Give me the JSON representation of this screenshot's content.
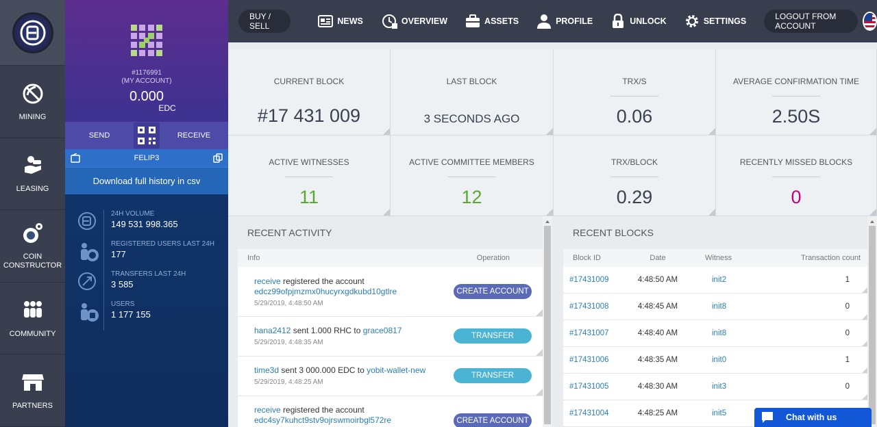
{
  "rail": {
    "items": [
      {
        "label": "MINING",
        "icon": "mining-icon"
      },
      {
        "label": "LEASING",
        "icon": "leasing-icon"
      },
      {
        "label": "COIN CONSTRUCTOR",
        "icon": "coin-constructor-icon"
      },
      {
        "label": "COMMUNITY",
        "icon": "community-icon"
      },
      {
        "label": "PARTNERS",
        "icon": "partners-icon"
      }
    ]
  },
  "account": {
    "number": "#1176991",
    "my_account": "(MY ACCOUNT)",
    "balance": "0.000",
    "currency": "EDC",
    "send": "SEND",
    "receive": "RECEIVE",
    "username": "FELIP3",
    "download": "Download full history in csv",
    "stats": [
      {
        "label": "24H VOLUME",
        "value": "149 531 998.365"
      },
      {
        "label": "REGISTERED USERS LAST 24H",
        "value": "177"
      },
      {
        "label": "TRANSFERS LAST 24H",
        "value": "3 585"
      },
      {
        "label": "USERS",
        "value": "1 177 155"
      }
    ]
  },
  "nav": {
    "buy_sell": "BUY / SELL",
    "news": "NEWS",
    "overview": "OVERVIEW",
    "assets": "ASSETS",
    "profile": "PROFILE",
    "unlock": "UNLOCK",
    "settings": "SETTINGS",
    "logout": "LOGOUT FROM ACCOUNT"
  },
  "tiles": [
    {
      "label": "CURRENT BLOCK",
      "value": "#17 431 009"
    },
    {
      "label": "LAST BLOCK",
      "value": "3 SECONDS AGO"
    },
    {
      "label": "TRX/S",
      "value": "0.06"
    },
    {
      "label": "AVERAGE CONFIRMATION TIME",
      "value": "2.50S"
    },
    {
      "label": "ACTIVE WITNESSES",
      "value": "11"
    },
    {
      "label": "ACTIVE COMMITTEE MEMBERS",
      "value": "12"
    },
    {
      "label": "TRX/BLOCK",
      "value": "0.29"
    },
    {
      "label": "RECENTLY MISSED BLOCKS",
      "value": "0"
    }
  ],
  "colors": {
    "green": "#5aa832",
    "magenta": "#c4007a",
    "dark": "#3a4150"
  },
  "activity": {
    "title": "RECENT ACTIVITY",
    "col_info": "Info",
    "col_op": "Operation",
    "rows": [
      {
        "who": "receive",
        "text": " registered the account",
        "target": "edcz99ofpjmzmx0hucyrxgdkubd10gtlre",
        "date": "5/29/2019, 4:48:50 AM",
        "op": "CREATE ACCOUNT"
      },
      {
        "who": "hana2412",
        "text": " sent 1.000 RHC to ",
        "target": "grace0817",
        "date": "5/29/2019, 4:48:35 AM",
        "op": "TRANSFER"
      },
      {
        "who": "time3d",
        "text": " sent 3 000.000 EDC to ",
        "target": "yobit-wallet-new",
        "date": "5/29/2019, 4:48:25 AM",
        "op": "TRANSFER"
      },
      {
        "who": "receive",
        "text": " registered the account",
        "target": "edc4sy7kuhct9stv9ojrswmoirbgl572re",
        "date": "",
        "op": "CREATE ACCOUNT"
      }
    ]
  },
  "blocks": {
    "title": "RECENT BLOCKS",
    "cols": [
      "Block ID",
      "Date",
      "Witness",
      "Transaction count"
    ],
    "rows": [
      {
        "id": "#17431009",
        "date": "4:48:50 AM",
        "witness": "init2",
        "count": "1"
      },
      {
        "id": "#17431008",
        "date": "4:48:45 AM",
        "witness": "init8",
        "count": "0"
      },
      {
        "id": "#17431007",
        "date": "4:48:40 AM",
        "witness": "init8",
        "count": "0"
      },
      {
        "id": "#17431006",
        "date": "4:48:35 AM",
        "witness": "init0",
        "count": "1"
      },
      {
        "id": "#17431005",
        "date": "4:48:30 AM",
        "witness": "init3",
        "count": "0"
      },
      {
        "id": "#17431004",
        "date": "4:48:25 AM",
        "witness": "init5",
        "count": ""
      }
    ]
  },
  "chat": "Chat with us"
}
